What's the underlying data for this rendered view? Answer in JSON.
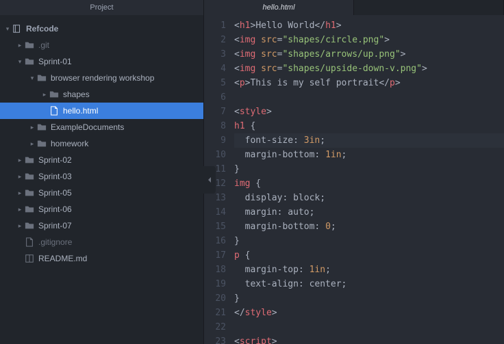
{
  "header": {
    "project": "Project"
  },
  "tabs": [
    {
      "label": "hello.html",
      "active": true
    },
    {
      "label": "",
      "active": false
    }
  ],
  "tree": {
    "root": "Refcode",
    "items": [
      {
        "depth": 1,
        "expand": "closed",
        "icon": "folder",
        "label": ".git",
        "dim": true
      },
      {
        "depth": 1,
        "expand": "open",
        "icon": "folder",
        "label": "Sprint-01"
      },
      {
        "depth": 2,
        "expand": "open",
        "icon": "folder",
        "label": "browser rendering workshop"
      },
      {
        "depth": 3,
        "expand": "closed",
        "icon": "folder",
        "label": "shapes"
      },
      {
        "depth": 3,
        "expand": "none",
        "icon": "file",
        "label": "hello.html",
        "selected": true
      },
      {
        "depth": 2,
        "expand": "closed",
        "icon": "folder",
        "label": "ExampleDocuments"
      },
      {
        "depth": 2,
        "expand": "closed",
        "icon": "folder",
        "label": "homework"
      },
      {
        "depth": 1,
        "expand": "closed",
        "icon": "folder",
        "label": "Sprint-02"
      },
      {
        "depth": 1,
        "expand": "closed",
        "icon": "folder",
        "label": "Sprint-03"
      },
      {
        "depth": 1,
        "expand": "closed",
        "icon": "folder",
        "label": "Sprint-05"
      },
      {
        "depth": 1,
        "expand": "closed",
        "icon": "folder",
        "label": "Sprint-06"
      },
      {
        "depth": 1,
        "expand": "closed",
        "icon": "folder",
        "label": "Sprint-07"
      },
      {
        "depth": 1,
        "expand": "none",
        "icon": "file",
        "label": ".gitignore",
        "dim": true
      },
      {
        "depth": 1,
        "expand": "none",
        "icon": "book",
        "label": "README.md"
      }
    ]
  },
  "code": {
    "lines": [
      [
        {
          "t": "<",
          "c": "punc"
        },
        {
          "t": "h1",
          "c": "tag"
        },
        {
          "t": ">",
          "c": "punc"
        },
        {
          "t": "Hello World",
          "c": "txt"
        },
        {
          "t": "</",
          "c": "punc"
        },
        {
          "t": "h1",
          "c": "tag"
        },
        {
          "t": ">",
          "c": "punc"
        }
      ],
      [
        {
          "t": "<",
          "c": "punc"
        },
        {
          "t": "img",
          "c": "tag"
        },
        {
          "t": " ",
          "c": "txt"
        },
        {
          "t": "src",
          "c": "attr"
        },
        {
          "t": "=",
          "c": "punc"
        },
        {
          "t": "\"shapes/circle.png\"",
          "c": "str"
        },
        {
          "t": ">",
          "c": "punc"
        }
      ],
      [
        {
          "t": "<",
          "c": "punc"
        },
        {
          "t": "img",
          "c": "tag"
        },
        {
          "t": " ",
          "c": "txt"
        },
        {
          "t": "src",
          "c": "attr"
        },
        {
          "t": "=",
          "c": "punc"
        },
        {
          "t": "\"shapes/arrows/up.png\"",
          "c": "str"
        },
        {
          "t": ">",
          "c": "punc"
        }
      ],
      [
        {
          "t": "<",
          "c": "punc"
        },
        {
          "t": "img",
          "c": "tag"
        },
        {
          "t": " ",
          "c": "txt"
        },
        {
          "t": "src",
          "c": "attr"
        },
        {
          "t": "=",
          "c": "punc"
        },
        {
          "t": "\"shapes/upside-down-v.png\"",
          "c": "str"
        },
        {
          "t": ">",
          "c": "punc"
        }
      ],
      [
        {
          "t": "<",
          "c": "punc"
        },
        {
          "t": "p",
          "c": "tag"
        },
        {
          "t": ">",
          "c": "punc"
        },
        {
          "t": "This is my self portrait",
          "c": "txt"
        },
        {
          "t": "</",
          "c": "punc"
        },
        {
          "t": "p",
          "c": "tag"
        },
        {
          "t": ">",
          "c": "punc"
        }
      ],
      [],
      [
        {
          "t": "<",
          "c": "punc"
        },
        {
          "t": "style",
          "c": "tag"
        },
        {
          "t": ">",
          "c": "punc"
        }
      ],
      [
        {
          "t": "h1",
          "c": "sel"
        },
        {
          "t": " {",
          "c": "punc"
        }
      ],
      [
        {
          "t": "  font-size: ",
          "c": "prop"
        },
        {
          "t": "3in",
          "c": "num"
        },
        {
          "t": ";",
          "c": "punc"
        }
      ],
      [
        {
          "t": "  margin-bottom: ",
          "c": "prop"
        },
        {
          "t": "1in",
          "c": "num"
        },
        {
          "t": ";",
          "c": "punc"
        }
      ],
      [
        {
          "t": "}",
          "c": "punc"
        }
      ],
      [
        {
          "t": "img",
          "c": "sel"
        },
        {
          "t": " {",
          "c": "punc"
        }
      ],
      [
        {
          "t": "  display: block;",
          "c": "prop"
        }
      ],
      [
        {
          "t": "  margin: auto;",
          "c": "prop"
        }
      ],
      [
        {
          "t": "  margin-bottom: ",
          "c": "prop"
        },
        {
          "t": "0",
          "c": "num"
        },
        {
          "t": ";",
          "c": "punc"
        }
      ],
      [
        {
          "t": "}",
          "c": "punc"
        }
      ],
      [
        {
          "t": "p",
          "c": "sel"
        },
        {
          "t": " {",
          "c": "punc"
        }
      ],
      [
        {
          "t": "  margin-top: ",
          "c": "prop"
        },
        {
          "t": "1in",
          "c": "num"
        },
        {
          "t": ";",
          "c": "punc"
        }
      ],
      [
        {
          "t": "  text-align: center;",
          "c": "prop"
        }
      ],
      [
        {
          "t": "}",
          "c": "punc"
        }
      ],
      [
        {
          "t": "</",
          "c": "punc"
        },
        {
          "t": "style",
          "c": "tag"
        },
        {
          "t": ">",
          "c": "punc"
        }
      ],
      [],
      [
        {
          "t": "<",
          "c": "punc"
        },
        {
          "t": "script",
          "c": "tag"
        },
        {
          "t": ">",
          "c": "punc"
        }
      ]
    ],
    "highlight": 9
  }
}
